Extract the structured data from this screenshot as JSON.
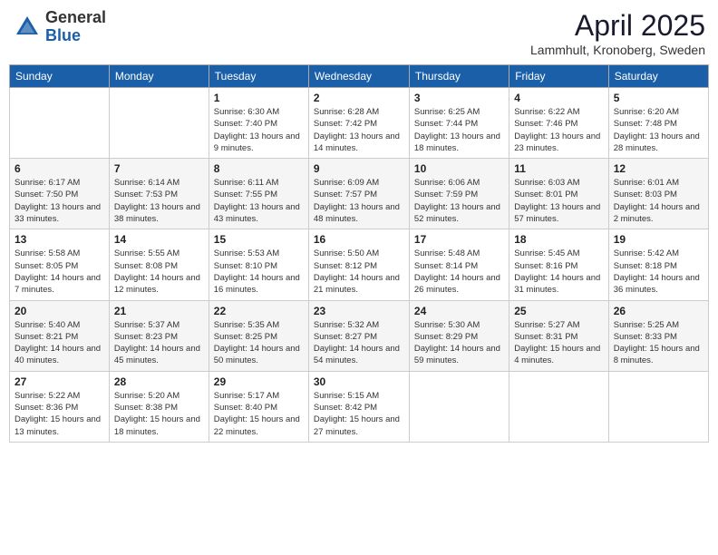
{
  "header": {
    "logo_general": "General",
    "logo_blue": "Blue",
    "month_title": "April 2025",
    "location": "Lammhult, Kronoberg, Sweden"
  },
  "days_of_week": [
    "Sunday",
    "Monday",
    "Tuesday",
    "Wednesday",
    "Thursday",
    "Friday",
    "Saturday"
  ],
  "weeks": [
    [
      {
        "day": "",
        "info": ""
      },
      {
        "day": "",
        "info": ""
      },
      {
        "day": "1",
        "info": "Sunrise: 6:30 AM\nSunset: 7:40 PM\nDaylight: 13 hours and 9 minutes."
      },
      {
        "day": "2",
        "info": "Sunrise: 6:28 AM\nSunset: 7:42 PM\nDaylight: 13 hours and 14 minutes."
      },
      {
        "day": "3",
        "info": "Sunrise: 6:25 AM\nSunset: 7:44 PM\nDaylight: 13 hours and 18 minutes."
      },
      {
        "day": "4",
        "info": "Sunrise: 6:22 AM\nSunset: 7:46 PM\nDaylight: 13 hours and 23 minutes."
      },
      {
        "day": "5",
        "info": "Sunrise: 6:20 AM\nSunset: 7:48 PM\nDaylight: 13 hours and 28 minutes."
      }
    ],
    [
      {
        "day": "6",
        "info": "Sunrise: 6:17 AM\nSunset: 7:50 PM\nDaylight: 13 hours and 33 minutes."
      },
      {
        "day": "7",
        "info": "Sunrise: 6:14 AM\nSunset: 7:53 PM\nDaylight: 13 hours and 38 minutes."
      },
      {
        "day": "8",
        "info": "Sunrise: 6:11 AM\nSunset: 7:55 PM\nDaylight: 13 hours and 43 minutes."
      },
      {
        "day": "9",
        "info": "Sunrise: 6:09 AM\nSunset: 7:57 PM\nDaylight: 13 hours and 48 minutes."
      },
      {
        "day": "10",
        "info": "Sunrise: 6:06 AM\nSunset: 7:59 PM\nDaylight: 13 hours and 52 minutes."
      },
      {
        "day": "11",
        "info": "Sunrise: 6:03 AM\nSunset: 8:01 PM\nDaylight: 13 hours and 57 minutes."
      },
      {
        "day": "12",
        "info": "Sunrise: 6:01 AM\nSunset: 8:03 PM\nDaylight: 14 hours and 2 minutes."
      }
    ],
    [
      {
        "day": "13",
        "info": "Sunrise: 5:58 AM\nSunset: 8:05 PM\nDaylight: 14 hours and 7 minutes."
      },
      {
        "day": "14",
        "info": "Sunrise: 5:55 AM\nSunset: 8:08 PM\nDaylight: 14 hours and 12 minutes."
      },
      {
        "day": "15",
        "info": "Sunrise: 5:53 AM\nSunset: 8:10 PM\nDaylight: 14 hours and 16 minutes."
      },
      {
        "day": "16",
        "info": "Sunrise: 5:50 AM\nSunset: 8:12 PM\nDaylight: 14 hours and 21 minutes."
      },
      {
        "day": "17",
        "info": "Sunrise: 5:48 AM\nSunset: 8:14 PM\nDaylight: 14 hours and 26 minutes."
      },
      {
        "day": "18",
        "info": "Sunrise: 5:45 AM\nSunset: 8:16 PM\nDaylight: 14 hours and 31 minutes."
      },
      {
        "day": "19",
        "info": "Sunrise: 5:42 AM\nSunset: 8:18 PM\nDaylight: 14 hours and 36 minutes."
      }
    ],
    [
      {
        "day": "20",
        "info": "Sunrise: 5:40 AM\nSunset: 8:21 PM\nDaylight: 14 hours and 40 minutes."
      },
      {
        "day": "21",
        "info": "Sunrise: 5:37 AM\nSunset: 8:23 PM\nDaylight: 14 hours and 45 minutes."
      },
      {
        "day": "22",
        "info": "Sunrise: 5:35 AM\nSunset: 8:25 PM\nDaylight: 14 hours and 50 minutes."
      },
      {
        "day": "23",
        "info": "Sunrise: 5:32 AM\nSunset: 8:27 PM\nDaylight: 14 hours and 54 minutes."
      },
      {
        "day": "24",
        "info": "Sunrise: 5:30 AM\nSunset: 8:29 PM\nDaylight: 14 hours and 59 minutes."
      },
      {
        "day": "25",
        "info": "Sunrise: 5:27 AM\nSunset: 8:31 PM\nDaylight: 15 hours and 4 minutes."
      },
      {
        "day": "26",
        "info": "Sunrise: 5:25 AM\nSunset: 8:33 PM\nDaylight: 15 hours and 8 minutes."
      }
    ],
    [
      {
        "day": "27",
        "info": "Sunrise: 5:22 AM\nSunset: 8:36 PM\nDaylight: 15 hours and 13 minutes."
      },
      {
        "day": "28",
        "info": "Sunrise: 5:20 AM\nSunset: 8:38 PM\nDaylight: 15 hours and 18 minutes."
      },
      {
        "day": "29",
        "info": "Sunrise: 5:17 AM\nSunset: 8:40 PM\nDaylight: 15 hours and 22 minutes."
      },
      {
        "day": "30",
        "info": "Sunrise: 5:15 AM\nSunset: 8:42 PM\nDaylight: 15 hours and 27 minutes."
      },
      {
        "day": "",
        "info": ""
      },
      {
        "day": "",
        "info": ""
      },
      {
        "day": "",
        "info": ""
      }
    ]
  ]
}
